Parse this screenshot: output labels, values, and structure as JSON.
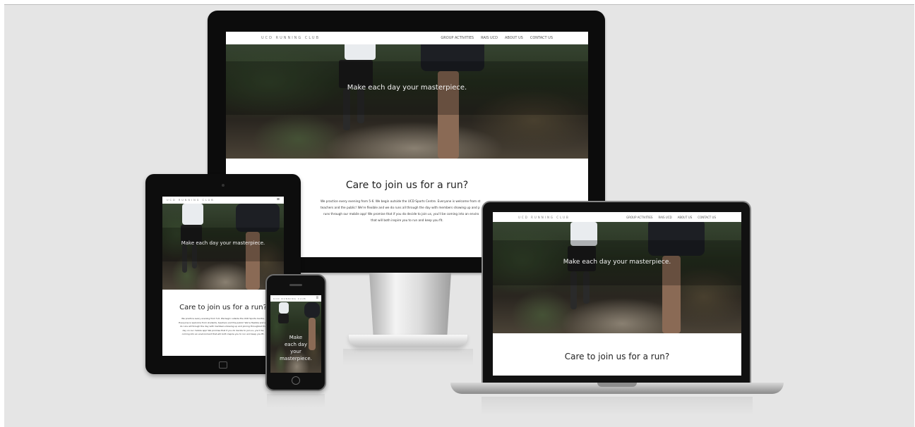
{
  "site": {
    "brand": "UCD RUNNING CLUB",
    "nav_links": [
      "GROUP ACTIVITIES",
      "RAIS UCD",
      "ABOUT US",
      "CONTACT US"
    ],
    "tagline": "Make each day your masterpiece.",
    "tagline_phone": [
      "Make",
      "each day",
      "your",
      "masterpiece."
    ],
    "section_title": "Care to join us for a run?",
    "section_text_lines": [
      "We practice every evening from 5-6. We begin outside the UCD Sports Centre. Everyone is welcome from st",
      "teachers and the public! We're flexible and we do runs all through the day with members showing up and p",
      "runs through our mobile app! We promise that if you do decide to join us, you'll be coming into an enviro",
      "that will both inspire you to run and keep you fit."
    ],
    "section_text_tablet_lines": [
      "We practice every evening from 5-6. We begin outside the UCD Sports Centre.",
      "Everyone is welcome from students, teachers and the public! We're flexible and we",
      "do runs all through the day with members showing up and joining throughout the",
      "day on our mobile app! We promise that if you do decide to join us, you'll be",
      "coming into an environment that will both inspire you to run and keep you fit."
    ],
    "menu_icon": "hamburger-icon"
  },
  "colors": {
    "background": "#e5e5e5",
    "device_frame": "#0c0c0c",
    "nav_bg": "#ffffff"
  }
}
